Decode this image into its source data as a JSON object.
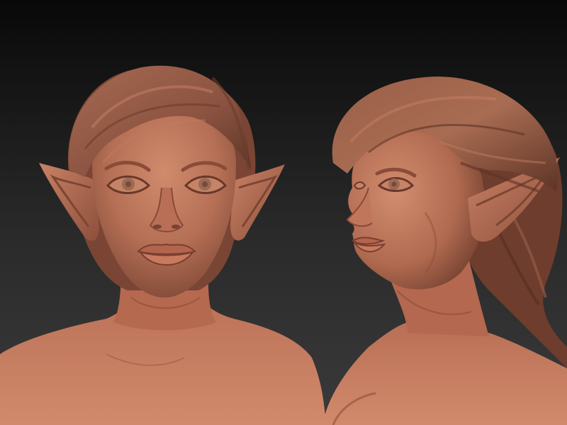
{
  "scene": {
    "background": "dark-gradient",
    "subjects": [
      "elf-bust-front-view",
      "elf-bust-three-quarter-view"
    ]
  },
  "colors": {
    "bg_top": "#080808",
    "bg_bottom": "#3a3a3a",
    "skin_light": "#c98266",
    "skin_mid": "#b06c52",
    "skin_dark": "#7c4634",
    "hair_light": "#a86a50",
    "hair_dark": "#5e3426",
    "eye": "#9a6a55"
  }
}
